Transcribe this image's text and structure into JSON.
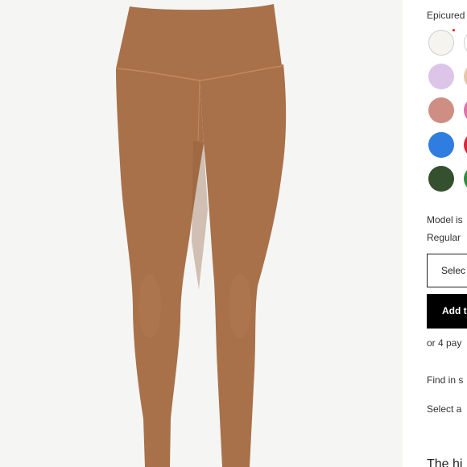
{
  "product": {
    "image_alt": "Brown high-rise leggings",
    "color_label": "Epicured",
    "color_selected_indicator_color": "#e02020",
    "swatches": [
      {
        "name": "ivory",
        "color": "#f5f4ef",
        "selected": true
      },
      {
        "name": "lilac",
        "color": "#dcc5e8"
      },
      {
        "name": "rose",
        "color": "#cf8e83"
      },
      {
        "name": "blue",
        "color": "#2f7de0"
      },
      {
        "name": "forest-green",
        "color": "#35502f"
      },
      {
        "name": "peach-partial",
        "color": "#e7c6a8"
      },
      {
        "name": "pink-partial",
        "color": "#e36fa8"
      },
      {
        "name": "red-partial",
        "color": "#d8263b"
      },
      {
        "name": "green-partial",
        "color": "#2f8c3c"
      }
    ],
    "model_info_line1": "Model is",
    "model_info_line2": "Regular",
    "size_select_label": "Selec",
    "add_button_label": "Add t",
    "payments_text": "or 4 pay",
    "find_in_store": "Find in s",
    "select_a": "Select a",
    "section_heading_peek": "The hi"
  },
  "colors": {
    "legging_fill": "#a8714a",
    "legging_shadow": "#8f5d3a",
    "legging_seam": "#c48a58",
    "gallery_bg": "#f5f5f4",
    "button_bg": "#000000"
  }
}
